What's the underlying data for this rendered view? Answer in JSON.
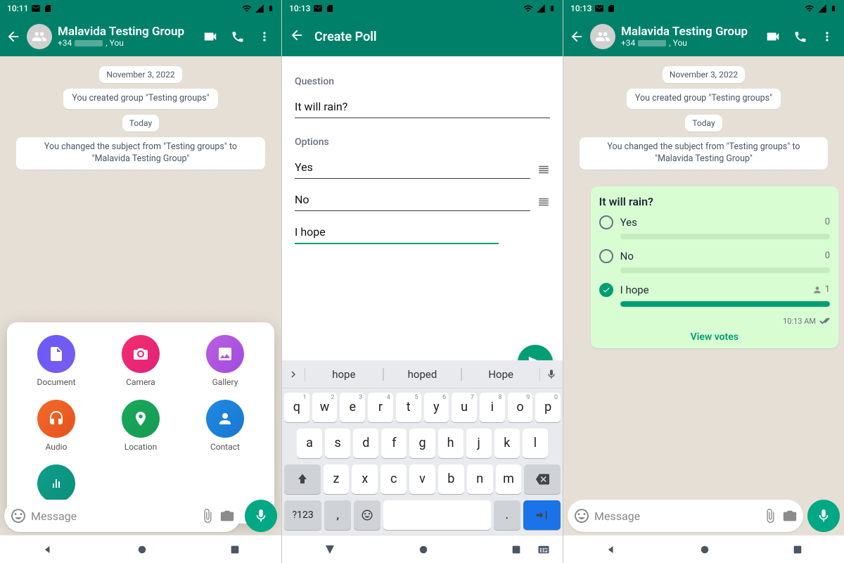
{
  "colors": {
    "primary": "#008069",
    "accent": "#00a884",
    "pollGreen": "#009e74"
  },
  "screens": {
    "s1": {
      "time": "10:11",
      "chatTitle": "Malavida Testing Group",
      "chatSubPrefix": "+34",
      "chatSubSuffix": ", You",
      "date": "November 3, 2022",
      "sysCreated": "You created group \"Testing groups\"",
      "today": "Today",
      "sysRename": "You changed the subject from \"Testing groups\" to \"Malavida Testing Group\"",
      "attach": {
        "document": "Document",
        "camera": "Camera",
        "gallery": "Gallery",
        "audio": "Audio",
        "location": "Location",
        "contact": "Contact",
        "poll": "Poll"
      },
      "inputPlaceholder": "Message"
    },
    "s2": {
      "time": "10:13",
      "title": "Create Poll",
      "qLabel": "Question",
      "qValue": "It will rain?",
      "optLabel": "Options",
      "opt1": "Yes",
      "opt2": "No",
      "opt3": "I hope",
      "suggest": {
        "a": "hope",
        "b": "hoped",
        "c": "Hope"
      },
      "numSymKey": "?123"
    },
    "s3": {
      "time": "10:13",
      "chatTitle": "Malavida Testing Group",
      "chatSubPrefix": "+34",
      "chatSubSuffix": ", You",
      "date": "November 3, 2022",
      "sysCreated": "You created group \"Testing groups\"",
      "today": "Today",
      "sysRename": "You changed the subject from \"Testing groups\" to \"Malavida Testing Group\"",
      "poll": {
        "question": "It will rain?",
        "o1": {
          "label": "Yes",
          "votes": "0",
          "pct": 0,
          "selected": false
        },
        "o2": {
          "label": "No",
          "votes": "0",
          "pct": 0,
          "selected": false
        },
        "o3": {
          "label": "I hope",
          "votes": "1",
          "pct": 100,
          "selected": true
        },
        "time": "10:13 AM",
        "viewVotes": "View votes"
      },
      "inputPlaceholder": "Message"
    }
  }
}
